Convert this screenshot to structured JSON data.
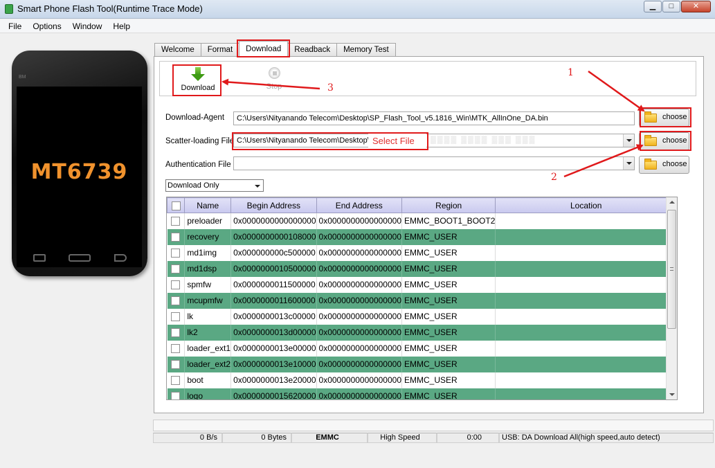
{
  "window": {
    "title": "Smart Phone Flash Tool(Runtime Trace Mode)",
    "minimize": "▁",
    "maximize": "□",
    "close": "✕"
  },
  "menu": [
    "File",
    "Options",
    "Window",
    "Help"
  ],
  "phone": {
    "model": "MT6739",
    "brand": "BM"
  },
  "tabs": [
    "Welcome",
    "Format",
    "Download",
    "Readback",
    "Memory Test"
  ],
  "active_tab": "Download",
  "toolbar": {
    "download_label": "Download",
    "stop_label": "Stop"
  },
  "form": {
    "download_agent_label": "Download-Agent",
    "download_agent_value": "C:\\Users\\Nityanando Telecom\\Desktop\\SP_Flash_Tool_v5.1816_Win\\MTK_AllInOne_DA.bin",
    "scatter_label": "Scatter-loading File",
    "scatter_value": "C:\\Users\\Nityanando Telecom\\Desktop\\",
    "select_file_note": "Select File",
    "auth_label": "Authentication File",
    "auth_value": "",
    "choose_label": "choose",
    "mode_value": "Download Only"
  },
  "table": {
    "columns": [
      "Name",
      "Begin Address",
      "End Address",
      "Region",
      "Location"
    ],
    "rows": [
      [
        "preloader",
        "0x0000000000000000",
        "0x0000000000000000",
        "EMMC_BOOT1_BOOT2",
        ""
      ],
      [
        "recovery",
        "0x0000000000108000",
        "0x0000000000000000",
        "EMMC_USER",
        ""
      ],
      [
        "md1img",
        "0x000000000c500000",
        "0x0000000000000000",
        "EMMC_USER",
        ""
      ],
      [
        "md1dsp",
        "0x0000000010500000",
        "0x0000000000000000",
        "EMMC_USER",
        ""
      ],
      [
        "spmfw",
        "0x0000000011500000",
        "0x0000000000000000",
        "EMMC_USER",
        ""
      ],
      [
        "mcupmfw",
        "0x0000000011600000",
        "0x0000000000000000",
        "EMMC_USER",
        ""
      ],
      [
        "lk",
        "0x0000000013c00000",
        "0x0000000000000000",
        "EMMC_USER",
        ""
      ],
      [
        "lk2",
        "0x0000000013d00000",
        "0x0000000000000000",
        "EMMC_USER",
        ""
      ],
      [
        "loader_ext1",
        "0x0000000013e00000",
        "0x0000000000000000",
        "EMMC_USER",
        ""
      ],
      [
        "loader_ext2",
        "0x0000000013e10000",
        "0x0000000000000000",
        "EMMC_USER",
        ""
      ],
      [
        "boot",
        "0x0000000013e20000",
        "0x0000000000000000",
        "EMMC_USER",
        ""
      ],
      [
        "logo",
        "0x0000000015620000",
        "0x0000000000000000",
        "EMMC_USER",
        ""
      ]
    ]
  },
  "status": {
    "speed": "0 B/s",
    "bytes": "0 Bytes",
    "storage": "EMMC",
    "mode": "High Speed",
    "time": "0:00",
    "usb": "USB: DA Download All(high speed,auto detect)"
  },
  "annotations": [
    "1",
    "2",
    "3"
  ],
  "colors": {
    "annotation": "#e0191b",
    "row_alt": "#5aa883",
    "header": "#c9c9ef",
    "phone_text": "#f0922d"
  }
}
